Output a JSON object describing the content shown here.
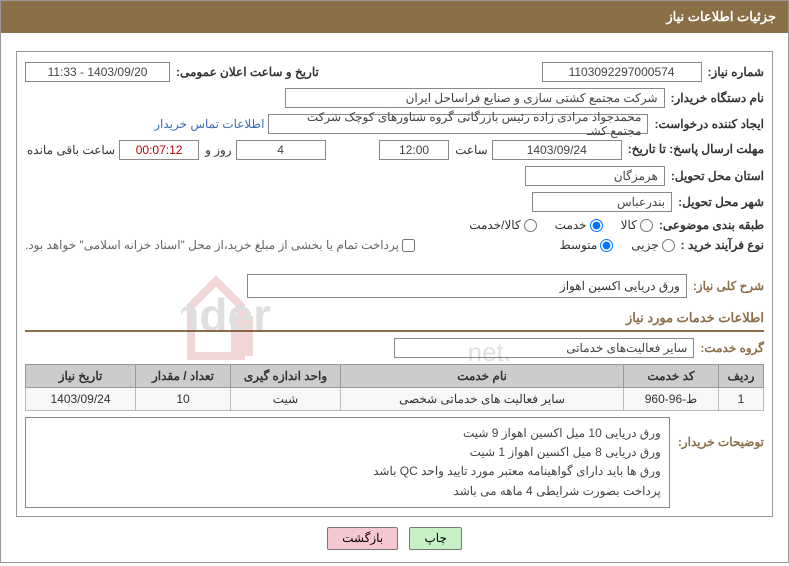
{
  "header": {
    "title": "جزئیات اطلاعات نیاز"
  },
  "need_number": {
    "label": "شماره نیاز:",
    "value": "1103092297000574"
  },
  "announce": {
    "label": "تاریخ و ساعت اعلان عمومی:",
    "value": "1403/09/20 - 11:33"
  },
  "buyer_org": {
    "label": "نام دستگاه خریدار:",
    "value": "شرکت مجتمع کشتی سازی و صنایع فراساحل ایران"
  },
  "requester": {
    "label": "ایجاد کننده درخواست:",
    "value": "محمدجواد مرادی زاده رئیس بازرگانی گروه شناورهای کوچک  شرکت مجتمع کشـ",
    "contact_link": "اطلاعات تماس خریدار"
  },
  "deadline": {
    "label": "مهلت ارسال پاسخ: تا تاریخ:",
    "date": "1403/09/24",
    "time_label": "ساعت",
    "time": "12:00",
    "days_label": "روز و",
    "days": "4",
    "remain_time": "00:07:12",
    "remain_label": "ساعت باقی مانده"
  },
  "province": {
    "label": "استان محل تحویل:",
    "value": "هرمزگان"
  },
  "city": {
    "label": "شهر محل تحویل:",
    "value": "بندرعباس"
  },
  "category": {
    "label": "طبقه بندی موضوعی:",
    "options": [
      {
        "label": "کالا",
        "checked": false
      },
      {
        "label": "خدمت",
        "checked": true
      },
      {
        "label": "کالا/خدمت",
        "checked": false
      }
    ]
  },
  "process_type": {
    "label": "نوع فرآیند خرید :",
    "options": [
      {
        "label": "جزیی",
        "checked": false
      },
      {
        "label": "متوسط",
        "checked": true
      }
    ],
    "payment_note": "پرداخت تمام یا بخشی از مبلغ خرید،از محل \"اسناد خزانه اسلامی\" خواهد بود."
  },
  "general_desc": {
    "label": "شرح کلی نیاز:",
    "value": "ورق دریایی اکسین اهواز"
  },
  "services_section": "اطلاعات خدمات مورد نیاز",
  "service_group": {
    "label": "گروه خدمت:",
    "value": "سایر فعالیت‌های خدماتی"
  },
  "table": {
    "headers": [
      "ردیف",
      "کد خدمت",
      "نام خدمت",
      "واحد اندازه گیری",
      "تعداد / مقدار",
      "تاریخ نیاز"
    ],
    "rows": [
      {
        "idx": "1",
        "code": "ط-96-960",
        "name": "سایر فعالیت های خدماتی شخصی",
        "unit": "شیت",
        "qty": "10",
        "date": "1403/09/24"
      }
    ]
  },
  "buyer_notes": {
    "label": "توضیحات خریدار:",
    "lines": [
      "ورق دریایی 10 میل اکسین اهواز 9 شیت",
      "ورق دریایی 8 میل اکسین اهواز 1 شیت",
      "ورق ها باید دارای گواهینامه معتبر مورد تایید واحد QC باشد",
      "پرداخت بصورت شرایطی 4 ماهه می باشد"
    ]
  },
  "buttons": {
    "print": "چاپ",
    "back": "بازگشت"
  },
  "watermark": "AriaTender.net"
}
